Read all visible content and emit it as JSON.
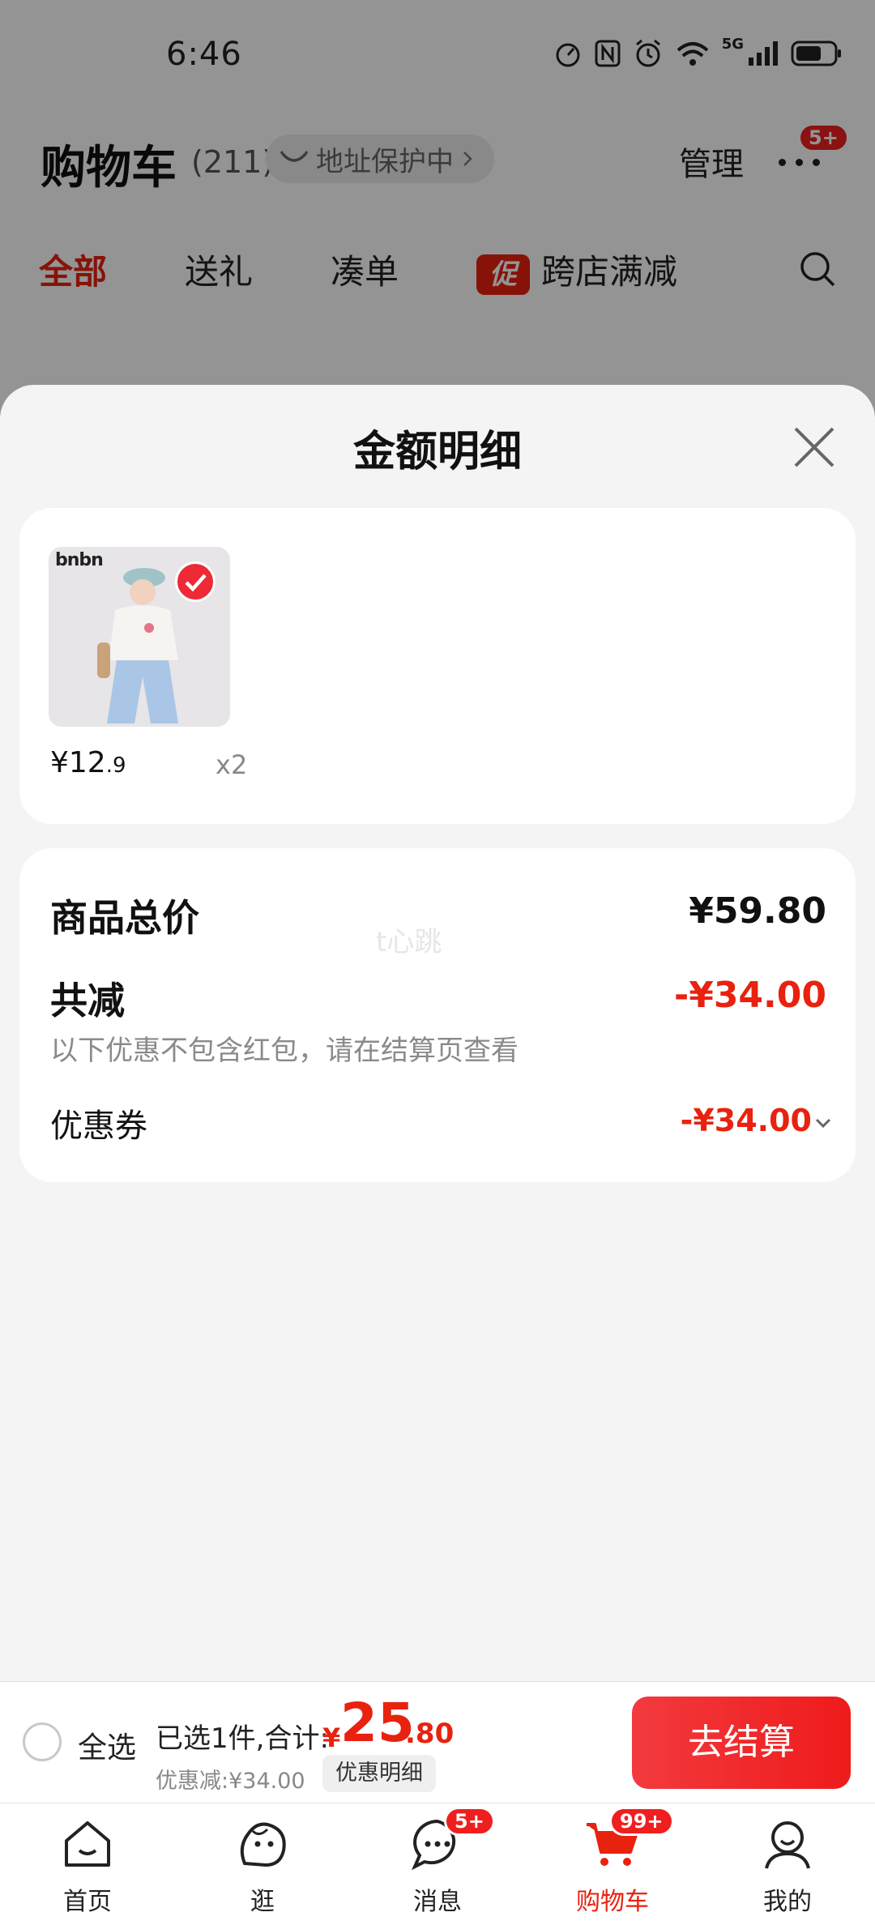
{
  "status_bar": {
    "time": "6:46",
    "network": "5G"
  },
  "cart_header": {
    "title": "购物车",
    "count": "(211)",
    "address_label": "地址保护中",
    "manage_label": "管理",
    "more_badge": "5+"
  },
  "tabs": [
    {
      "label": "全部",
      "active": true
    },
    {
      "label": "送礼"
    },
    {
      "label": "凑单"
    },
    {
      "label": "跨店满减",
      "tag": "促"
    }
  ],
  "sheet": {
    "title": "金额明细",
    "items": [
      {
        "brand_logo": "bnbn",
        "price_int": "¥12",
        "price_dec": ".9",
        "quantity": "x2",
        "selected": true
      }
    ],
    "summary": {
      "watermark": "t心跳",
      "goods_total_label": "商品总价",
      "goods_total_value": "¥59.80",
      "total_discount_label": "共减",
      "total_discount_value": "-¥34.00",
      "discount_note": "以下优惠不包含红包，请在结算页查看",
      "coupon_label": "优惠券",
      "coupon_value": "-¥34.00"
    }
  },
  "checkout": {
    "select_all_label": "全选",
    "selected_text": "已选1件,合计:",
    "currency": "¥",
    "total_int": "25",
    "total_dec": ".80",
    "discount_text": "优惠减:¥34.00",
    "discount_detail_label": "优惠明细",
    "checkout_label": "去结算"
  },
  "bottom_nav": [
    {
      "label": "首页",
      "icon": "home-icon"
    },
    {
      "label": "逛",
      "icon": "browse-icon"
    },
    {
      "label": "消息",
      "icon": "message-icon",
      "badge": "5+"
    },
    {
      "label": "购物车",
      "icon": "cart-icon",
      "badge": "99+",
      "active": true
    },
    {
      "label": "我的",
      "icon": "profile-icon"
    }
  ],
  "colors": {
    "accent": "#e8220f",
    "sheet_bg": "#f4f4f4",
    "checkout_button": "#ef1b1b"
  }
}
